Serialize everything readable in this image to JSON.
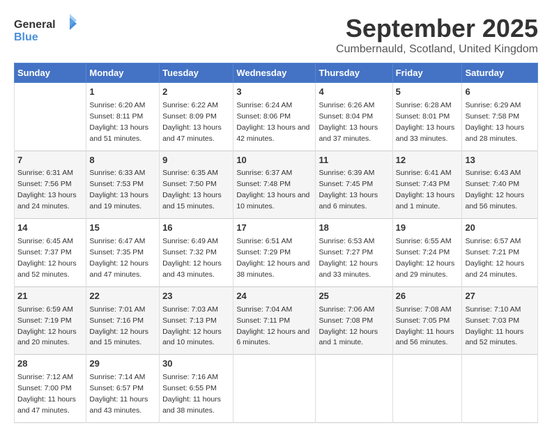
{
  "logo": {
    "line1": "General",
    "line2": "Blue"
  },
  "title": "September 2025",
  "location": "Cumbernauld, Scotland, United Kingdom",
  "days_header": [
    "Sunday",
    "Monday",
    "Tuesday",
    "Wednesday",
    "Thursday",
    "Friday",
    "Saturday"
  ],
  "weeks": [
    [
      {
        "num": "",
        "sunrise": "",
        "sunset": "",
        "daylight": ""
      },
      {
        "num": "1",
        "sunrise": "Sunrise: 6:20 AM",
        "sunset": "Sunset: 8:11 PM",
        "daylight": "Daylight: 13 hours and 51 minutes."
      },
      {
        "num": "2",
        "sunrise": "Sunrise: 6:22 AM",
        "sunset": "Sunset: 8:09 PM",
        "daylight": "Daylight: 13 hours and 47 minutes."
      },
      {
        "num": "3",
        "sunrise": "Sunrise: 6:24 AM",
        "sunset": "Sunset: 8:06 PM",
        "daylight": "Daylight: 13 hours and 42 minutes."
      },
      {
        "num": "4",
        "sunrise": "Sunrise: 6:26 AM",
        "sunset": "Sunset: 8:04 PM",
        "daylight": "Daylight: 13 hours and 37 minutes."
      },
      {
        "num": "5",
        "sunrise": "Sunrise: 6:28 AM",
        "sunset": "Sunset: 8:01 PM",
        "daylight": "Daylight: 13 hours and 33 minutes."
      },
      {
        "num": "6",
        "sunrise": "Sunrise: 6:29 AM",
        "sunset": "Sunset: 7:58 PM",
        "daylight": "Daylight: 13 hours and 28 minutes."
      }
    ],
    [
      {
        "num": "7",
        "sunrise": "Sunrise: 6:31 AM",
        "sunset": "Sunset: 7:56 PM",
        "daylight": "Daylight: 13 hours and 24 minutes."
      },
      {
        "num": "8",
        "sunrise": "Sunrise: 6:33 AM",
        "sunset": "Sunset: 7:53 PM",
        "daylight": "Daylight: 13 hours and 19 minutes."
      },
      {
        "num": "9",
        "sunrise": "Sunrise: 6:35 AM",
        "sunset": "Sunset: 7:50 PM",
        "daylight": "Daylight: 13 hours and 15 minutes."
      },
      {
        "num": "10",
        "sunrise": "Sunrise: 6:37 AM",
        "sunset": "Sunset: 7:48 PM",
        "daylight": "Daylight: 13 hours and 10 minutes."
      },
      {
        "num": "11",
        "sunrise": "Sunrise: 6:39 AM",
        "sunset": "Sunset: 7:45 PM",
        "daylight": "Daylight: 13 hours and 6 minutes."
      },
      {
        "num": "12",
        "sunrise": "Sunrise: 6:41 AM",
        "sunset": "Sunset: 7:43 PM",
        "daylight": "Daylight: 13 hours and 1 minute."
      },
      {
        "num": "13",
        "sunrise": "Sunrise: 6:43 AM",
        "sunset": "Sunset: 7:40 PM",
        "daylight": "Daylight: 12 hours and 56 minutes."
      }
    ],
    [
      {
        "num": "14",
        "sunrise": "Sunrise: 6:45 AM",
        "sunset": "Sunset: 7:37 PM",
        "daylight": "Daylight: 12 hours and 52 minutes."
      },
      {
        "num": "15",
        "sunrise": "Sunrise: 6:47 AM",
        "sunset": "Sunset: 7:35 PM",
        "daylight": "Daylight: 12 hours and 47 minutes."
      },
      {
        "num": "16",
        "sunrise": "Sunrise: 6:49 AM",
        "sunset": "Sunset: 7:32 PM",
        "daylight": "Daylight: 12 hours and 43 minutes."
      },
      {
        "num": "17",
        "sunrise": "Sunrise: 6:51 AM",
        "sunset": "Sunset: 7:29 PM",
        "daylight": "Daylight: 12 hours and 38 minutes."
      },
      {
        "num": "18",
        "sunrise": "Sunrise: 6:53 AM",
        "sunset": "Sunset: 7:27 PM",
        "daylight": "Daylight: 12 hours and 33 minutes."
      },
      {
        "num": "19",
        "sunrise": "Sunrise: 6:55 AM",
        "sunset": "Sunset: 7:24 PM",
        "daylight": "Daylight: 12 hours and 29 minutes."
      },
      {
        "num": "20",
        "sunrise": "Sunrise: 6:57 AM",
        "sunset": "Sunset: 7:21 PM",
        "daylight": "Daylight: 12 hours and 24 minutes."
      }
    ],
    [
      {
        "num": "21",
        "sunrise": "Sunrise: 6:59 AM",
        "sunset": "Sunset: 7:19 PM",
        "daylight": "Daylight: 12 hours and 20 minutes."
      },
      {
        "num": "22",
        "sunrise": "Sunrise: 7:01 AM",
        "sunset": "Sunset: 7:16 PM",
        "daylight": "Daylight: 12 hours and 15 minutes."
      },
      {
        "num": "23",
        "sunrise": "Sunrise: 7:03 AM",
        "sunset": "Sunset: 7:13 PM",
        "daylight": "Daylight: 12 hours and 10 minutes."
      },
      {
        "num": "24",
        "sunrise": "Sunrise: 7:04 AM",
        "sunset": "Sunset: 7:11 PM",
        "daylight": "Daylight: 12 hours and 6 minutes."
      },
      {
        "num": "25",
        "sunrise": "Sunrise: 7:06 AM",
        "sunset": "Sunset: 7:08 PM",
        "daylight": "Daylight: 12 hours and 1 minute."
      },
      {
        "num": "26",
        "sunrise": "Sunrise: 7:08 AM",
        "sunset": "Sunset: 7:05 PM",
        "daylight": "Daylight: 11 hours and 56 minutes."
      },
      {
        "num": "27",
        "sunrise": "Sunrise: 7:10 AM",
        "sunset": "Sunset: 7:03 PM",
        "daylight": "Daylight: 11 hours and 52 minutes."
      }
    ],
    [
      {
        "num": "28",
        "sunrise": "Sunrise: 7:12 AM",
        "sunset": "Sunset: 7:00 PM",
        "daylight": "Daylight: 11 hours and 47 minutes."
      },
      {
        "num": "29",
        "sunrise": "Sunrise: 7:14 AM",
        "sunset": "Sunset: 6:57 PM",
        "daylight": "Daylight: 11 hours and 43 minutes."
      },
      {
        "num": "30",
        "sunrise": "Sunrise: 7:16 AM",
        "sunset": "Sunset: 6:55 PM",
        "daylight": "Daylight: 11 hours and 38 minutes."
      },
      {
        "num": "",
        "sunrise": "",
        "sunset": "",
        "daylight": ""
      },
      {
        "num": "",
        "sunrise": "",
        "sunset": "",
        "daylight": ""
      },
      {
        "num": "",
        "sunrise": "",
        "sunset": "",
        "daylight": ""
      },
      {
        "num": "",
        "sunrise": "",
        "sunset": "",
        "daylight": ""
      }
    ]
  ]
}
